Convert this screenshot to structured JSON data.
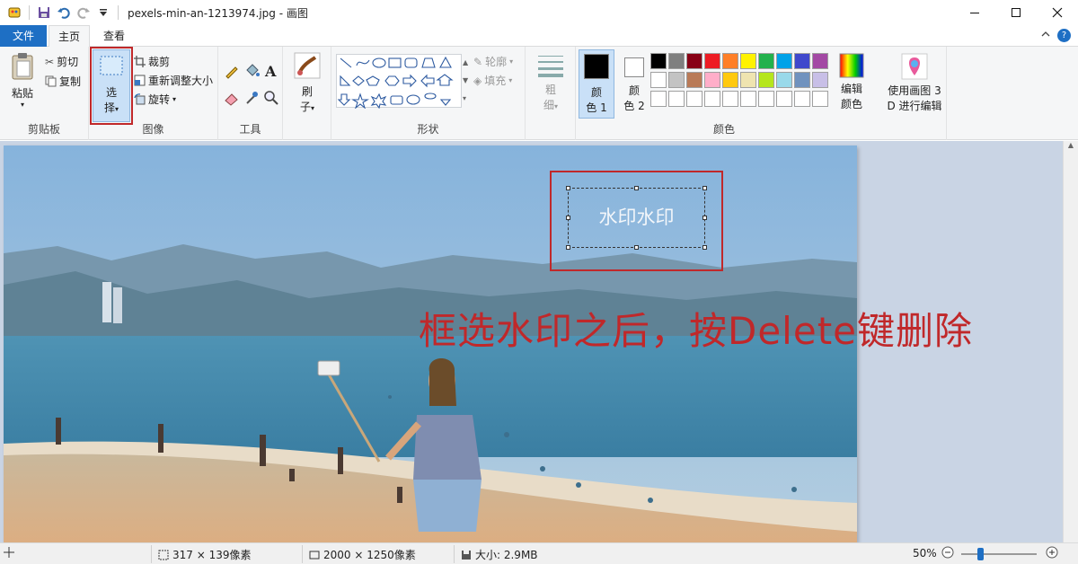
{
  "window": {
    "title": "pexels-min-an-1213974.jpg - 画图",
    "minimize_icon": "minimize-icon",
    "maximize_icon": "maximize-icon",
    "close_icon": "close-icon"
  },
  "tabs": [
    "文件",
    "主页",
    "查看"
  ],
  "ribbon": {
    "clipboard": {
      "paste": "粘贴",
      "cut": "剪切",
      "copy": "复制",
      "label": "剪贴板"
    },
    "image": {
      "select": "选",
      "select2": "择",
      "crop": "裁剪",
      "resize": "重新调整大小",
      "rotate": "旋转",
      "label": "图像"
    },
    "tools": {
      "label": "工具"
    },
    "brushes": {
      "b1": "刷",
      "b2": "子"
    },
    "shapes": {
      "outline": "轮廓",
      "fill": "填充",
      "label": "形状"
    },
    "size": {
      "s1": "粗",
      "s2": "细"
    },
    "colors": {
      "color1_a": "颜",
      "color1_b": "色 1",
      "color2_a": "颜",
      "color2_b": "色 2",
      "edit_a": "编辑",
      "edit_b": "颜色",
      "paint3d_a": "使用画图 3",
      "paint3d_b": "D 进行编辑",
      "label": "颜色",
      "palette_row1": [
        "#000000",
        "#7f7f7f",
        "#880015",
        "#ed1c24",
        "#ff7f27",
        "#fff200",
        "#22b14c",
        "#00a2e8",
        "#3f48cc",
        "#a349a4"
      ],
      "palette_row2": [
        "#ffffff",
        "#c3c3c3",
        "#b97a57",
        "#ffaec9",
        "#ffc90e",
        "#efe4b0",
        "#b5e61d",
        "#99d9ea",
        "#7092be",
        "#c8bfe7"
      ]
    }
  },
  "canvas": {
    "watermark_text": "水印水印",
    "instruction": "框选水印之后，按Delete键删除"
  },
  "status": {
    "selection_size": "317 × 139像素",
    "image_size": "2000 × 1250像素",
    "file_size": "大小: 2.9MB",
    "zoom": "50%"
  }
}
